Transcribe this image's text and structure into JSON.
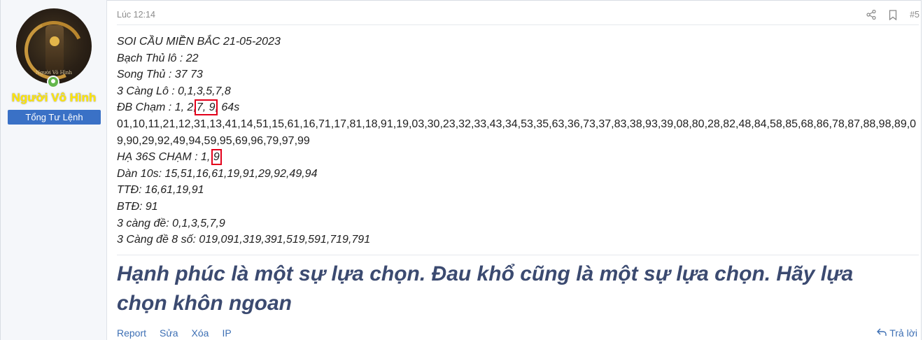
{
  "user": {
    "avatar_caption": "Người Vô Hình",
    "name": "Người Vô Hình",
    "title": "Tổng Tư Lệnh"
  },
  "post": {
    "time": "Lúc 12:14",
    "number": "#5",
    "lines": {
      "l1": "SOI CẦU MIỀN BẮC 21-05-2023",
      "l2": "Bạch Thủ lô : 22",
      "l3": "Song Thủ : 37 73",
      "l4": "3 Càng Lô : 0,1,3,5,7,8",
      "l5a": "ĐB Chạm : 1, 2,",
      "l5b": "7, 9",
      "l5c": ", 64s",
      "l6": "01,10,11,21,12,31,13,41,14,51,15,61,16,71,17,81,18,91,19,03,30,23,32,33,43,34,53,35,63,36,73,37,83,38,93,39,08,80,28,82,48,84,58,85,68,86,78,87,88,98,89,09,90,29,92,49,94,59,95,69,96,79,97,99",
      "l7a": "HẠ 36S CHẠM : 1,",
      "l7b": "9",
      "l8": "Dàn 10s: 15,51,16,61,19,91,29,92,49,94",
      "l9": "TTĐ: 16,61,19,91",
      "l10": "BTĐ: 91",
      "l11": "3 càng đề: 0,1,3,5,7,9",
      "l12": "3 Càng đề 8 số: 019,091,319,391,519,591,719,791"
    },
    "signature": "Hạnh phúc là một sự lựa chọn. Đau khổ cũng là một sự lựa chọn. Hãy lựa chọn khôn ngoan"
  },
  "footer": {
    "report": "Report",
    "edit": "Sửa",
    "delete": "Xóa",
    "ip": "IP",
    "reply": "Trả lời"
  },
  "icons": {
    "share": "share-icon",
    "bookmark": "bookmark-icon",
    "reply": "reply-icon",
    "online": "online-status-icon"
  },
  "colors": {
    "username": "#ffe600",
    "title_badge": "#3a71c6",
    "signature": "#3b4a70",
    "link": "#3d6fb4",
    "highlight_box": "#e3001b"
  }
}
